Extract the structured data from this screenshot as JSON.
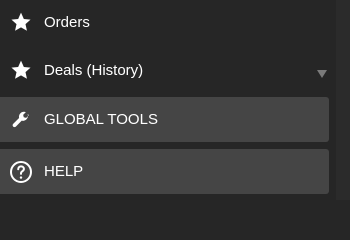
{
  "menu": {
    "items": [
      {
        "label": "Orders",
        "icon": "star-icon"
      },
      {
        "label": "Deals (History)",
        "icon": "star-icon"
      }
    ]
  },
  "sections": {
    "global_tools": {
      "label": "GLOBAL TOOLS",
      "icon": "wrench-icon"
    },
    "help": {
      "label": "HELP",
      "icon": "question-circle-icon"
    }
  },
  "colors": {
    "background": "#262626",
    "section_background": "#454545",
    "text": "#ffffff",
    "scroll_arrow": "#7a7a7a"
  }
}
